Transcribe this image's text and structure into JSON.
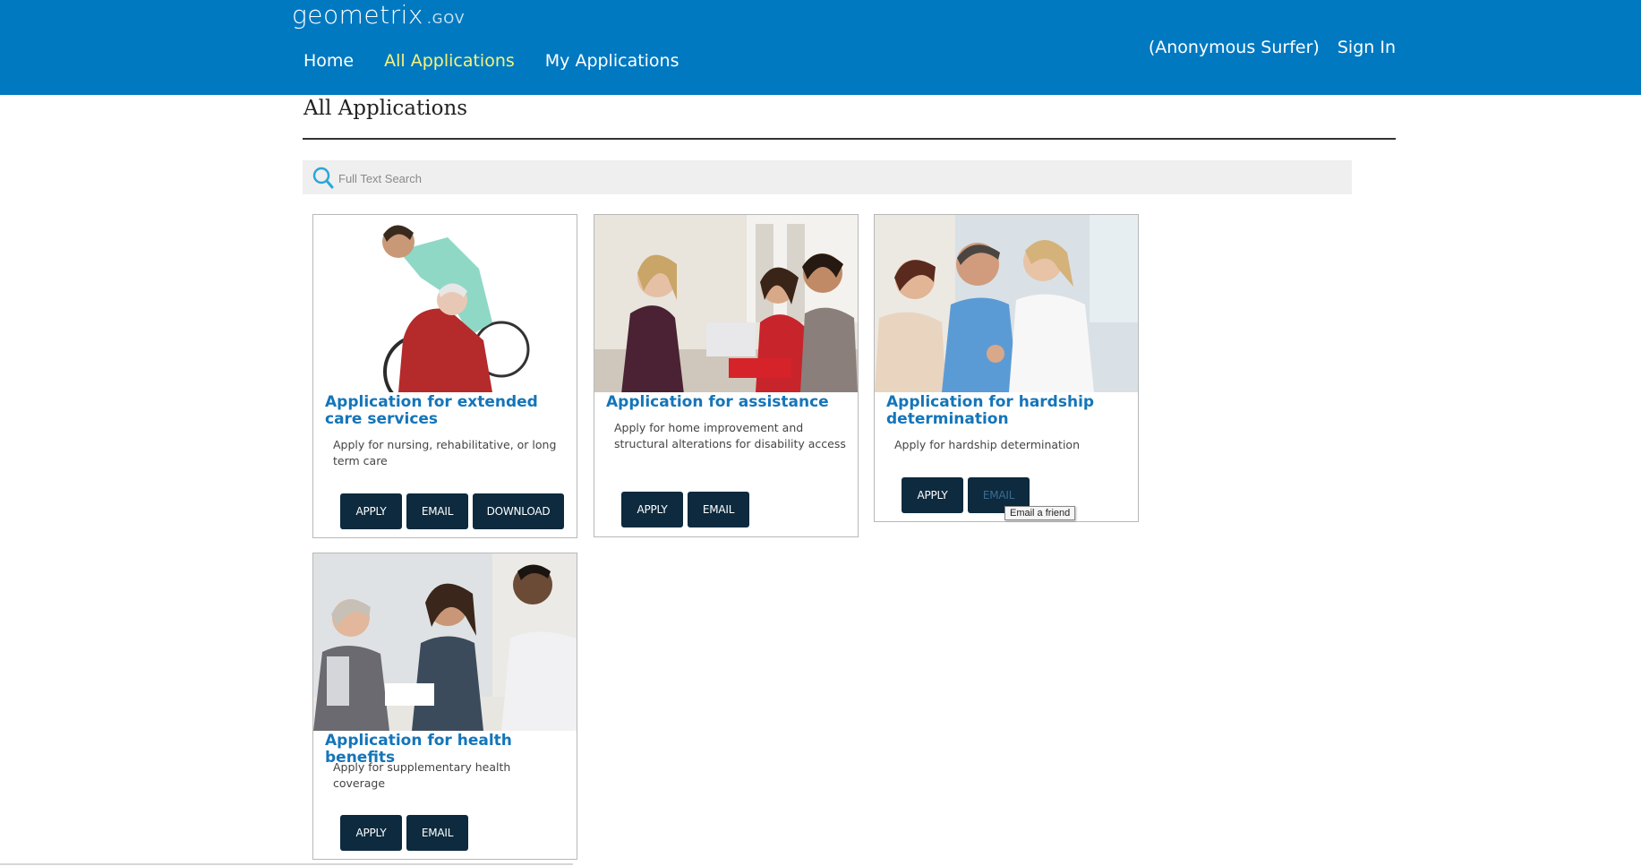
{
  "header": {
    "logo_main": "geometrix",
    "logo_tld": ".GOV",
    "nav": [
      {
        "label": "Home"
      },
      {
        "label": "All Applications",
        "active": true
      },
      {
        "label": "My Applications"
      }
    ],
    "user_name": "(Anonymous Surfer)",
    "sign_in": "Sign In",
    "brand_color": "#0079c1",
    "active_nav_color": "#f9f37a"
  },
  "page": {
    "title": "All Applications"
  },
  "search": {
    "placeholder": "Full Text Search",
    "icon": "search-icon"
  },
  "cards": [
    {
      "title": "Application for extended care services",
      "description": "Apply for nursing, rehabilitative, or long term care",
      "image": "nurse-with-patient-in-wheelchair",
      "buttons": [
        "APPLY",
        "EMAIL",
        "DOWNLOAD"
      ]
    },
    {
      "title": "Application for assistance",
      "description": "Apply for home improvement and structural alterations for disability access",
      "image": "advisor-meeting-couple",
      "buttons": [
        "APPLY",
        "EMAIL"
      ]
    },
    {
      "title": "Application for hardship determination",
      "description": "Apply for hardship determination",
      "image": "doctor-greeting-couple",
      "buttons": [
        "APPLY",
        "EMAIL"
      ]
    },
    {
      "title": "Application for health benefits",
      "description": "Apply for supplementary health coverage",
      "image": "doctor-meeting-patients",
      "buttons": [
        "APPLY",
        "EMAIL"
      ]
    }
  ],
  "tooltip": "Email a friend",
  "button_color": "#0d2a3e",
  "title_color": "#1475b9"
}
